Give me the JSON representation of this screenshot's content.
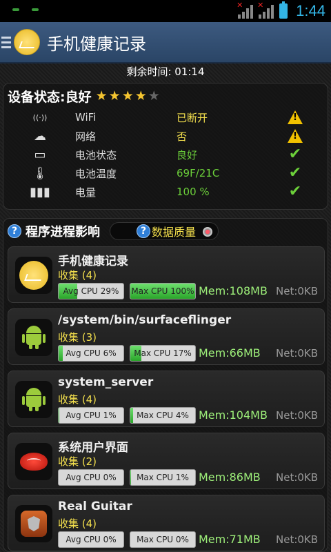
{
  "status_bar": {
    "time": "1:44"
  },
  "header": {
    "title": "手机健康记录"
  },
  "timer": {
    "text": "剩余时间: 01:14"
  },
  "device": {
    "label": "设备状态:良好",
    "rating": 4,
    "rating_max": 5,
    "rows": [
      {
        "name": "WiFi",
        "value": "已断开",
        "value_color": "#f4e04d",
        "status": "warning",
        "icon": "wifi-icon"
      },
      {
        "name": "网络",
        "value": "否",
        "value_color": "#f4e04d",
        "status": "warning",
        "icon": "cloud-icon"
      },
      {
        "name": "电池状态",
        "value": "良好",
        "value_color": "#6cd03a",
        "status": "ok",
        "icon": "battery-status-icon"
      },
      {
        "name": "电池温度",
        "value": "69F/21C",
        "value_color": "#6cd03a",
        "status": "ok",
        "icon": "thermometer-icon"
      },
      {
        "name": "电量",
        "value": "100 %",
        "value_color": "#6cd03a",
        "status": "ok",
        "icon": "battery-level-icon"
      }
    ]
  },
  "process": {
    "label": "程序进程影响",
    "quality_label": "数据质量",
    "items": [
      {
        "name": "手机健康记录",
        "collect": "收集 (4)",
        "avg": "Avg CPU 29%",
        "avg_pct": 29,
        "max": "Max CPU 100%",
        "max_pct": 100,
        "mem": "Mem:108MB",
        "net": "Net:0KB",
        "icon": "health-app-icon"
      },
      {
        "name": "/system/bin/surfaceflinger",
        "collect": "收集 (3)",
        "avg": "Avg CPU 6%",
        "avg_pct": 6,
        "max": "Max CPU 17%",
        "max_pct": 17,
        "mem": "Mem:66MB",
        "net": "Net:0KB",
        "icon": "android-icon"
      },
      {
        "name": "system_server",
        "collect": "收集 (4)",
        "avg": "Avg CPU 1%",
        "avg_pct": 1,
        "max": "Max CPU 4%",
        "max_pct": 4,
        "mem": "Mem:104MB",
        "net": "Net:0KB",
        "icon": "android-icon"
      },
      {
        "name": "系统用户界面",
        "collect": "收集 (2)",
        "avg": "Avg CPU 0%",
        "avg_pct": 0,
        "max": "Max CPU 1%",
        "max_pct": 1,
        "mem": "Mem:86MB",
        "net": "Net:0KB",
        "icon": "jellybean-icon"
      },
      {
        "name": "Real Guitar",
        "collect": "收集 (4)",
        "avg": "Avg CPU 0%",
        "avg_pct": 0,
        "max": "Max CPU 0%",
        "max_pct": 0,
        "mem": "Mem:71MB",
        "net": "Net:0KB",
        "icon": "guitar-icon"
      }
    ]
  }
}
